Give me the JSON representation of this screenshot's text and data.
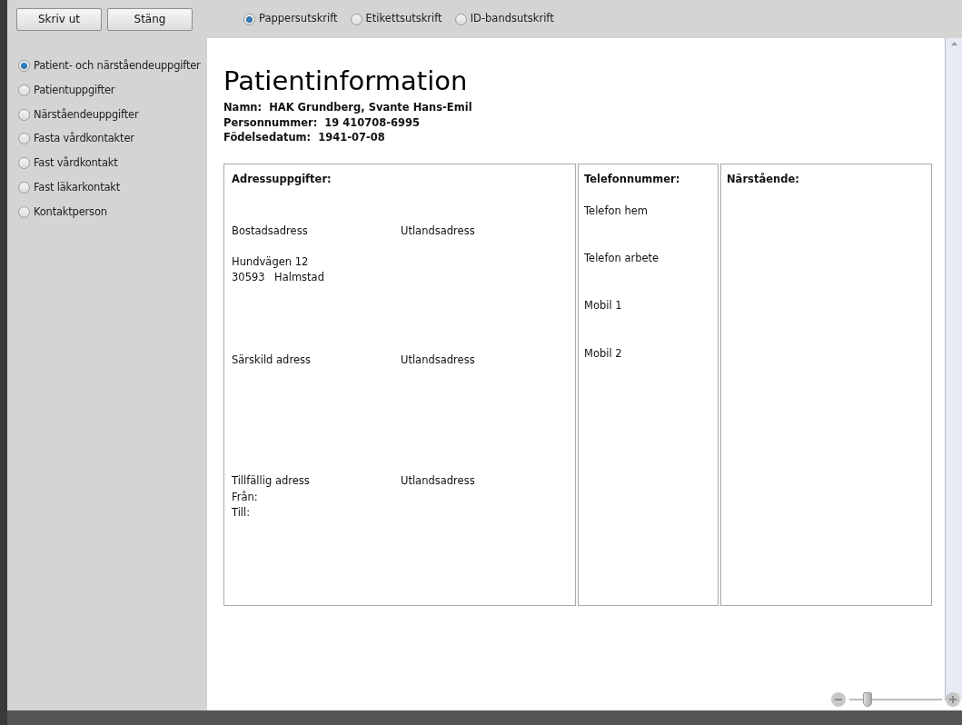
{
  "toolbar": {
    "buttons": [
      "Skriv ut",
      "Stäng"
    ],
    "print_types": [
      {
        "label": "Pappersutskrift",
        "selected": true
      },
      {
        "label": "Etikettsutskrift",
        "selected": false
      },
      {
        "label": "ID-bandsutskrift",
        "selected": false
      }
    ]
  },
  "sidebar": {
    "items": [
      {
        "label": "Patient- och närståendeuppgifter",
        "selected": true
      },
      {
        "label": "Patientuppgifter",
        "selected": false
      },
      {
        "label": "Närståendeuppgifter",
        "selected": false
      },
      {
        "label": "Fasta vårdkontakter",
        "selected": false
      },
      {
        "label": "Fast vårdkontakt",
        "selected": false
      },
      {
        "label": "Fast läkarkontakt",
        "selected": false
      },
      {
        "label": "Kontaktperson",
        "selected": false
      }
    ]
  },
  "document": {
    "title": "Patientinformation",
    "fields": [
      {
        "label": "Namn:",
        "value": "HAK Grundberg, Svante Hans-Emil"
      },
      {
        "label": "Personnummer:",
        "value": "19 410708-6995"
      },
      {
        "label": "Födelsedatum:",
        "value": "1941-07-08"
      }
    ],
    "address": {
      "heading": "Adressuppgifter:",
      "sections": [
        {
          "label": "Bostadsadress",
          "foreign": "Utlandsadress",
          "lines": [
            "Hundvägen 12"
          ],
          "postcode": "30593",
          "city": "Halmstad"
        },
        {
          "label": "Särskild adress",
          "foreign": "Utlandsadress"
        },
        {
          "label": "Tillfällig adress",
          "foreign": "Utlandsadress",
          "lines": [
            "Från:",
            "Till:"
          ]
        }
      ]
    },
    "phones": {
      "heading": "Telefonnummer:",
      "items": [
        "Telefon hem",
        "Telefon arbete",
        "Mobil 1",
        "Mobil 2"
      ]
    },
    "relatives": {
      "heading": "Närstående:"
    }
  },
  "zoom": {
    "level": 0.2
  }
}
